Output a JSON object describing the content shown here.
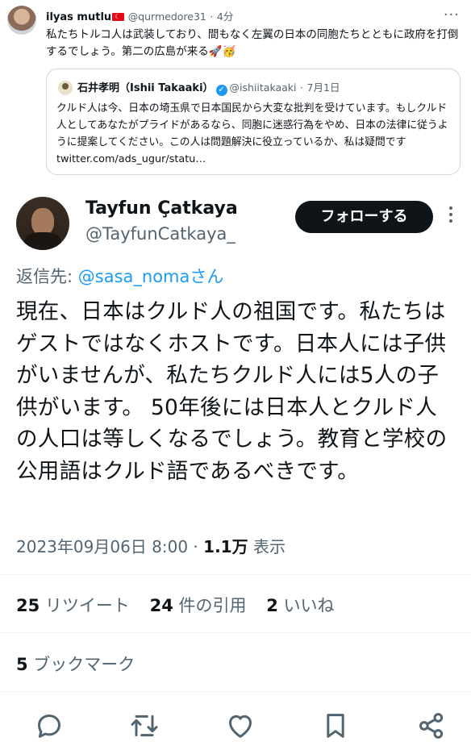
{
  "top_tweet": {
    "author_name": "ilyas mutlu",
    "handle": "@qurmedore31",
    "time": "4分",
    "text": "私たちトルコ人は武装しており、間もなく左翼の日本の同胞たちとともに政府を打倒するでしょう。第二の広島が来る🚀🥳"
  },
  "quoted_tweet": {
    "author_name": "石井孝明（Ishii Takaaki）",
    "handle": "@ishiitakaaki",
    "date": "7月1日",
    "text": "クルド人は今、日本の埼玉県で日本国民から大変な批判を受けています。もしクルド人としてあなたがプライドがあるなら、同胞に迷惑行為をやめ、日本の法律に従うように提案してください。この人は問題解決に役立っているか、私は疑問です twitter.com/ads_ugur/statu…"
  },
  "main_tweet": {
    "author_name": "Tayfun Çatkaya",
    "handle": "@TayfunCatkaya_",
    "follow_label": "フォローする",
    "reply_prefix": "返信先: ",
    "reply_mention": "@sasa_nomaさん",
    "text": "現在、日本はクルド人の祖国です。私たちはゲストではなくホストです。日本人には子供がいませんが、私たちクルド人には5人の子供がいます。 50年後には日本人とクルド人の人口は等しくなるでしょう。教育と学校の公用語はクルド語であるべきです。",
    "timestamp": "2023年09月06日 8:00",
    "dot": " · ",
    "views_count": "1.1万",
    "views_label": " 表示"
  },
  "stats": {
    "retweets_count": "25",
    "retweets_label": " リツイート",
    "quotes_count": "24",
    "quotes_label": " 件の引用",
    "likes_count": "2",
    "likes_label": " いいね",
    "bookmarks_count": "5",
    "bookmarks_label": " ブックマーク"
  },
  "colors": {
    "accent": "#1d9bf0",
    "text": "#0f1419",
    "secondary": "#536471",
    "border": "#cfd9de"
  },
  "icons": [
    "more-icon",
    "verified-icon",
    "reply-icon",
    "retweet-icon",
    "like-icon",
    "bookmark-icon",
    "share-icon"
  ]
}
